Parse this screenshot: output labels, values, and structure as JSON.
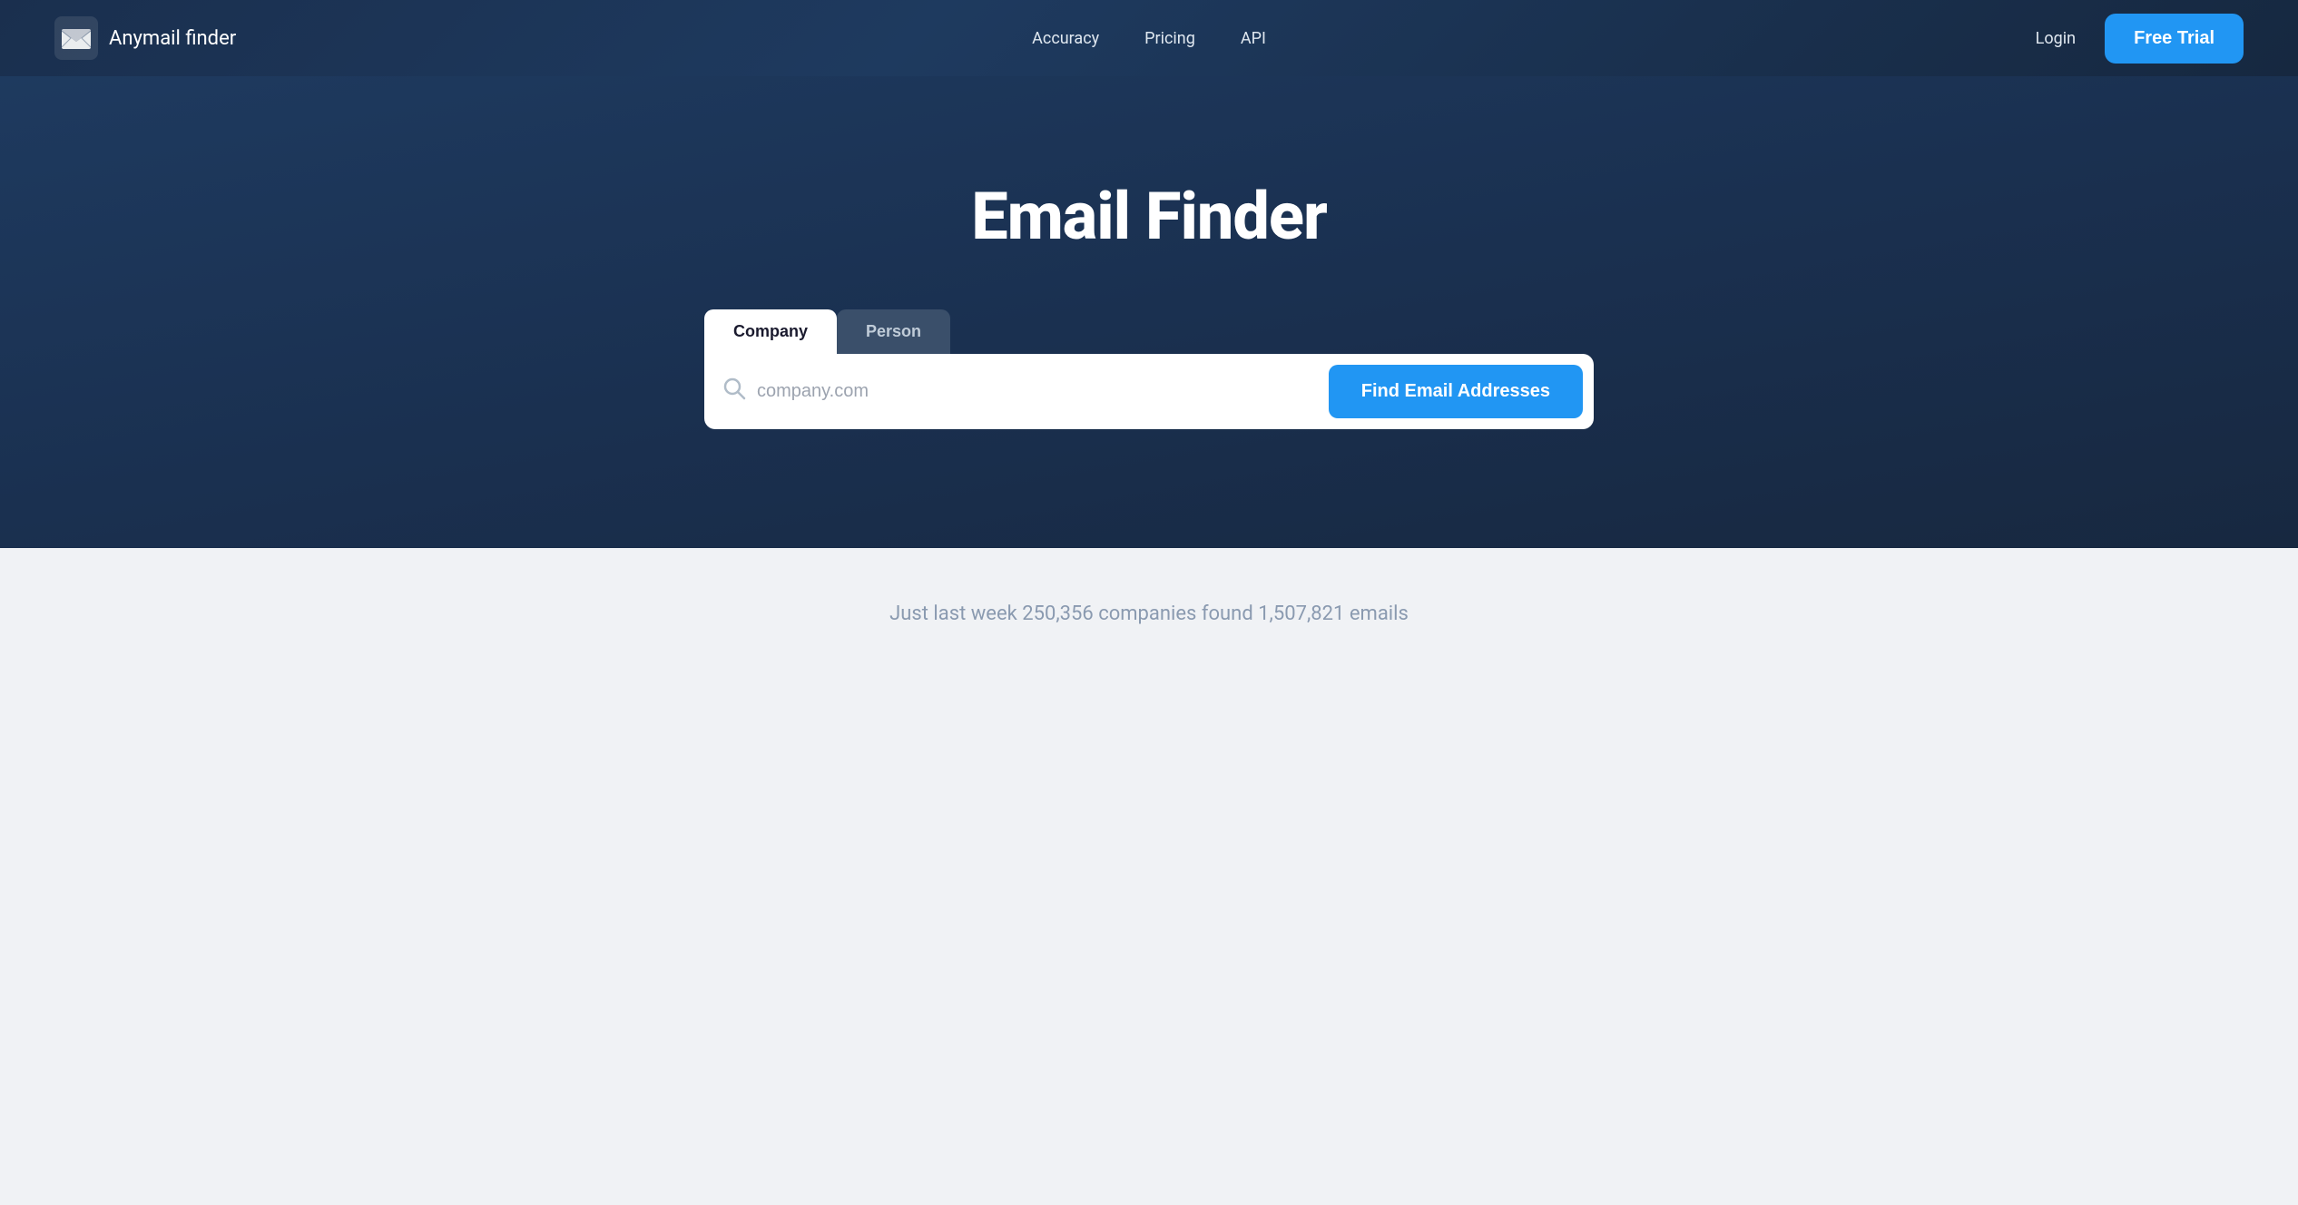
{
  "header": {
    "logo_text": "Anymail finder",
    "nav": {
      "accuracy": "Accuracy",
      "pricing": "Pricing",
      "api": "API"
    },
    "login_label": "Login",
    "free_trial_label": "Free Trial"
  },
  "hero": {
    "title": "Email Finder",
    "tabs": [
      {
        "id": "company",
        "label": "Company",
        "active": true
      },
      {
        "id": "person",
        "label": "Person",
        "active": false
      }
    ],
    "search_placeholder": "company.com",
    "find_button_label": "Find Email Addresses"
  },
  "stats": {
    "text": "Just last week 250,356 companies found 1,507,821 emails"
  },
  "icons": {
    "search": "🔍"
  }
}
